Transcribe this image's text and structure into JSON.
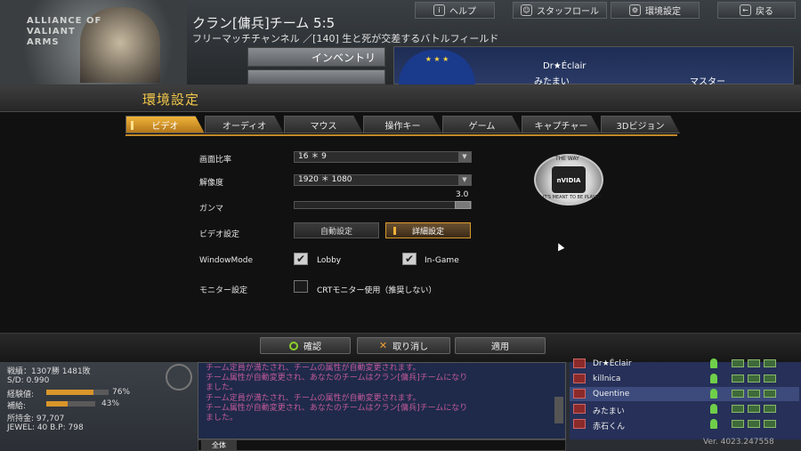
{
  "header": {
    "logo_text": "ALLIANCE OF VALIANT ARMS",
    "clan_title": "クラン[傭兵]チーム 5:5",
    "channel": "フリーマッチチャンネル ／[140] 生と死が交差するバトルフィールド",
    "buttons": {
      "help": "ヘルプ",
      "staffroll": "スタッフロール",
      "settings": "環境設定",
      "back": "戻る"
    },
    "inventory": "インベントリ",
    "players_top": [
      "Dr★Éclair",
      "みたまい"
    ],
    "master_label": "マスター"
  },
  "dialog": {
    "title": "環境設定",
    "tabs": [
      "ビデオ",
      "オーディオ",
      "マウス",
      "操作キー",
      "ゲーム",
      "キャプチャー",
      "3Dビジョン"
    ],
    "active_tab": "ビデオ",
    "aspect_label": "画面比率",
    "aspect_value": "16 ＊ 9",
    "resolution_label": "解像度",
    "resolution_value": "1920 ＊ 1080",
    "gamma_label": "ガンマ",
    "gamma_value": "3.0",
    "video_label": "ビデオ設定",
    "auto_btn": "自動設定",
    "detail_btn": "詳細設定",
    "windowmode_label": "WindowMode",
    "lobby_label": "Lobby",
    "ingame_label": "In-Game",
    "monitor_label": "モニター設定",
    "crt_label": "CRTモニター使用（推奨しない）",
    "nvidia_top": "THE WAY",
    "nvidia_logo": "nVIDIA",
    "nvidia_bottom": "IT'S MEANT TO BE PLAYED",
    "confirm": "確認",
    "cancel": "取り消し",
    "apply": "適用"
  },
  "stats": {
    "record": "戦績：1307勝 1481敗",
    "sd": "S/D: 0.990",
    "exp_label": "経験値:",
    "exp_pct": "76%",
    "exp_fraction": 0.76,
    "sub_label": "補給:",
    "sub_pct": "43%",
    "sub_fraction": 0.43,
    "money": "所持金: 97,707",
    "jewel": "JEWEL: 40  B.P: 798"
  },
  "chat": {
    "lines": [
      "チーム定員が満たされ、チームの属性が自動変更されます。",
      "チーム属性が自動変更され、あなたのチームはクラン[傭兵]チームになり",
      "ました。",
      "チーム定員が満たされ、チームの属性が自動変更されます。",
      "チーム属性が自動変更され、あなたのチームはクラン[傭兵]チームになり",
      "ました。"
    ],
    "tab": "全体"
  },
  "players": [
    "Dr★Éclair",
    "killnica",
    "Quentine",
    "みたまい",
    "赤石くん"
  ],
  "version": "Ver. 4023.247558"
}
